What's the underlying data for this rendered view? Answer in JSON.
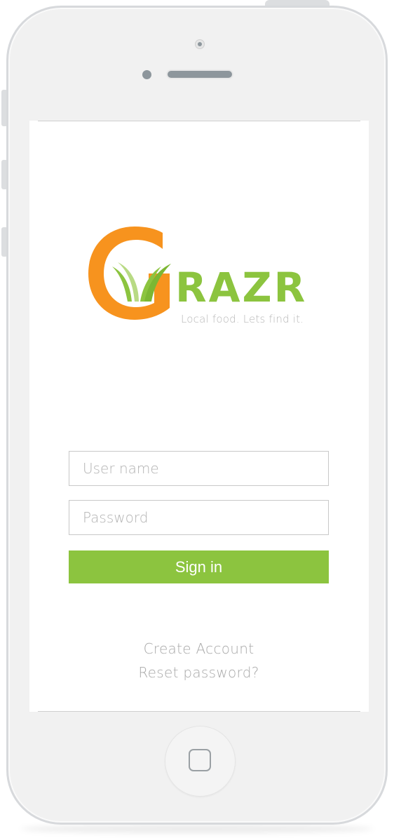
{
  "logo": {
    "initial": "G",
    "wordmark": "RAZR",
    "tagline": "Local food. Lets find it.",
    "colors": {
      "orange": "#f7931e",
      "green": "#8cc43f"
    }
  },
  "login": {
    "username_placeholder": "User name",
    "password_placeholder": "Password",
    "signin_label": "Sign in"
  },
  "links": {
    "create_account": "Create Account",
    "reset_password": "Reset password?"
  },
  "device": {
    "home_icon": "home-button-icon",
    "camera_icon": "front-camera-icon",
    "speaker_icon": "earpiece-speaker-icon"
  }
}
